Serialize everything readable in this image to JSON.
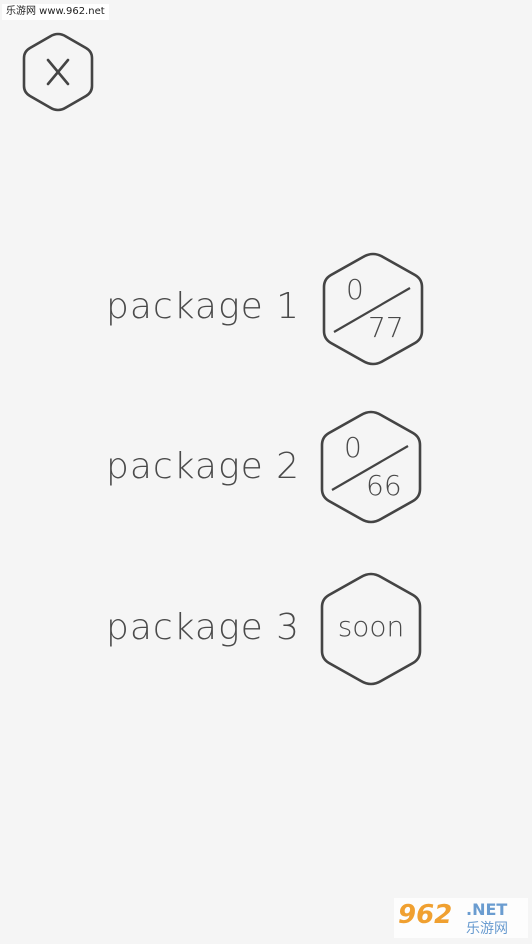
{
  "watermark_top": "乐游网 www.962.net",
  "packages": [
    {
      "label": "package 1",
      "completed": "0",
      "total": "77"
    },
    {
      "label": "package 2",
      "completed": "0",
      "total": "66"
    },
    {
      "label": "package 3",
      "status": "soon"
    }
  ],
  "watermark_bottom": {
    "number": "962",
    "domain": ".NET",
    "cn": "乐游网"
  }
}
